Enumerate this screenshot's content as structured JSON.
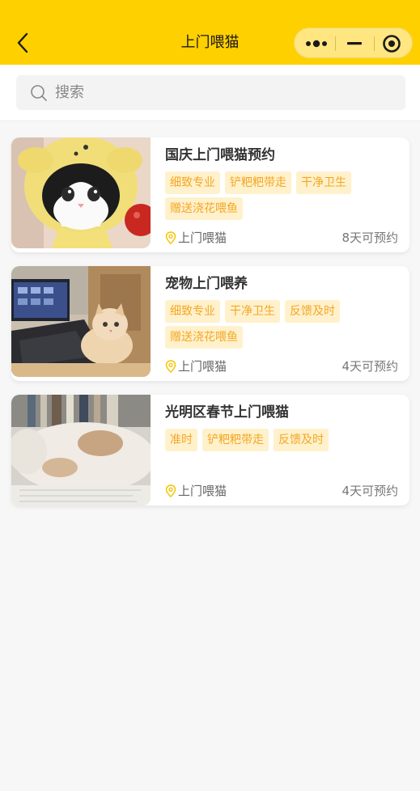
{
  "nav": {
    "title": "上门喂猫",
    "back_icon": "chevron-left-icon",
    "capsule": {
      "more_icon": "more-dots-icon",
      "minimize_icon": "minimize-icon",
      "close_icon": "target-close-icon"
    },
    "accent_color": "#ffd000"
  },
  "search": {
    "placeholder": "搜索",
    "value": "",
    "icon": "search-icon"
  },
  "services": [
    {
      "name": "国庆上门喂猫预约",
      "tags": [
        "细致专业",
        "铲粑粑带走",
        "干净卫生",
        "赠送浇花喂鱼"
      ],
      "location": "上门喂猫",
      "availability": "8天可预约",
      "image": "kitten-in-yellow-hoodie"
    },
    {
      "name": "宠物上门喂养",
      "tags": [
        "细致专业",
        "干净卫生",
        "反馈及时",
        "赠送浇花喂鱼"
      ],
      "location": "上门喂猫",
      "availability": "4天可预约",
      "image": "kitten-on-laptop"
    },
    {
      "name": "光明区春节上门喂猫",
      "tags": [
        "准时",
        "铲粑粑带走",
        "反馈及时"
      ],
      "location": "上门喂猫",
      "availability": "4天可预约",
      "image": "fluffy-cat-sleeping"
    }
  ],
  "colors": {
    "tag_text": "#f5a623",
    "tag_bg": "#fff1cc",
    "location_icon": "#f5c400"
  }
}
